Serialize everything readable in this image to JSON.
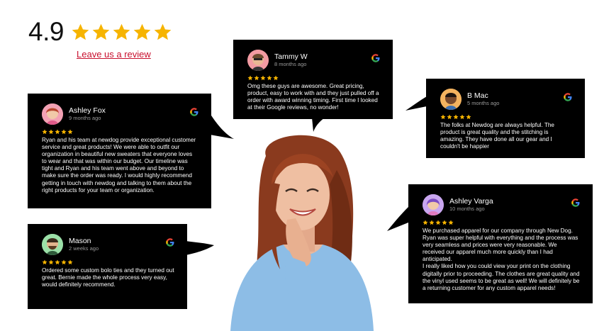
{
  "rating": {
    "score": "4.9",
    "stars": 5,
    "star_color": "#f6b400",
    "link": "Leave us a review"
  },
  "colors": {
    "card_bg": "#000000",
    "link_red": "#c8102e",
    "star": "#f6b400"
  },
  "reviews": [
    {
      "name": "Ashley Fox",
      "ago": "9 months ago",
      "text": "Ryan and his team at newdog provide exceptional customer service and great products! We were able to outfit our organization in beautiful new sweaters that everyone loves to wear and that was within our budget. Our timeline was tight and Ryan and his team went above and beyond to make sure the order was ready. I would highly recommend getting in touch with newdog and talking to them about the right products for your team or organization.",
      "icon": "google-icon"
    },
    {
      "name": "Tammy W",
      "ago": "8 months ago",
      "text": "Omg these guys are awesome. Great pricing, product, easy to work with and they just pulled off a order with award winning timing. First time I looked at their Google reviews, no wonder!",
      "icon": "google-icon"
    },
    {
      "name": "B Mac",
      "ago": "5 months ago",
      "text": "The folks at Newdog are always helpful. The product is great quality and the stitching is amazing. They have done all our gear and I couldn't be happier",
      "icon": "google-icon"
    },
    {
      "name": "Mason",
      "ago": "2 weeks ago",
      "text": "Ordered some custom bolo ties and they turned out great. Bernie made the whole process very easy, would definitely recommend.",
      "icon": "google-icon"
    },
    {
      "name": "Ashley Varga",
      "ago": "10 months ago",
      "text": "We purchased apparel for our company through New Dog. Ryan was super helpful with everything and the process was very seamless and prices were very reasonable. We received our apparel much more quickly than I had anticipated.\nI really liked how you could view your print on the clothing digitally prior to proceeding. The clothes are great quality and the vinyl used seems to be great as well! We will definitely be a returning customer for any custom apparel needs!",
      "icon": "google-icon"
    }
  ]
}
